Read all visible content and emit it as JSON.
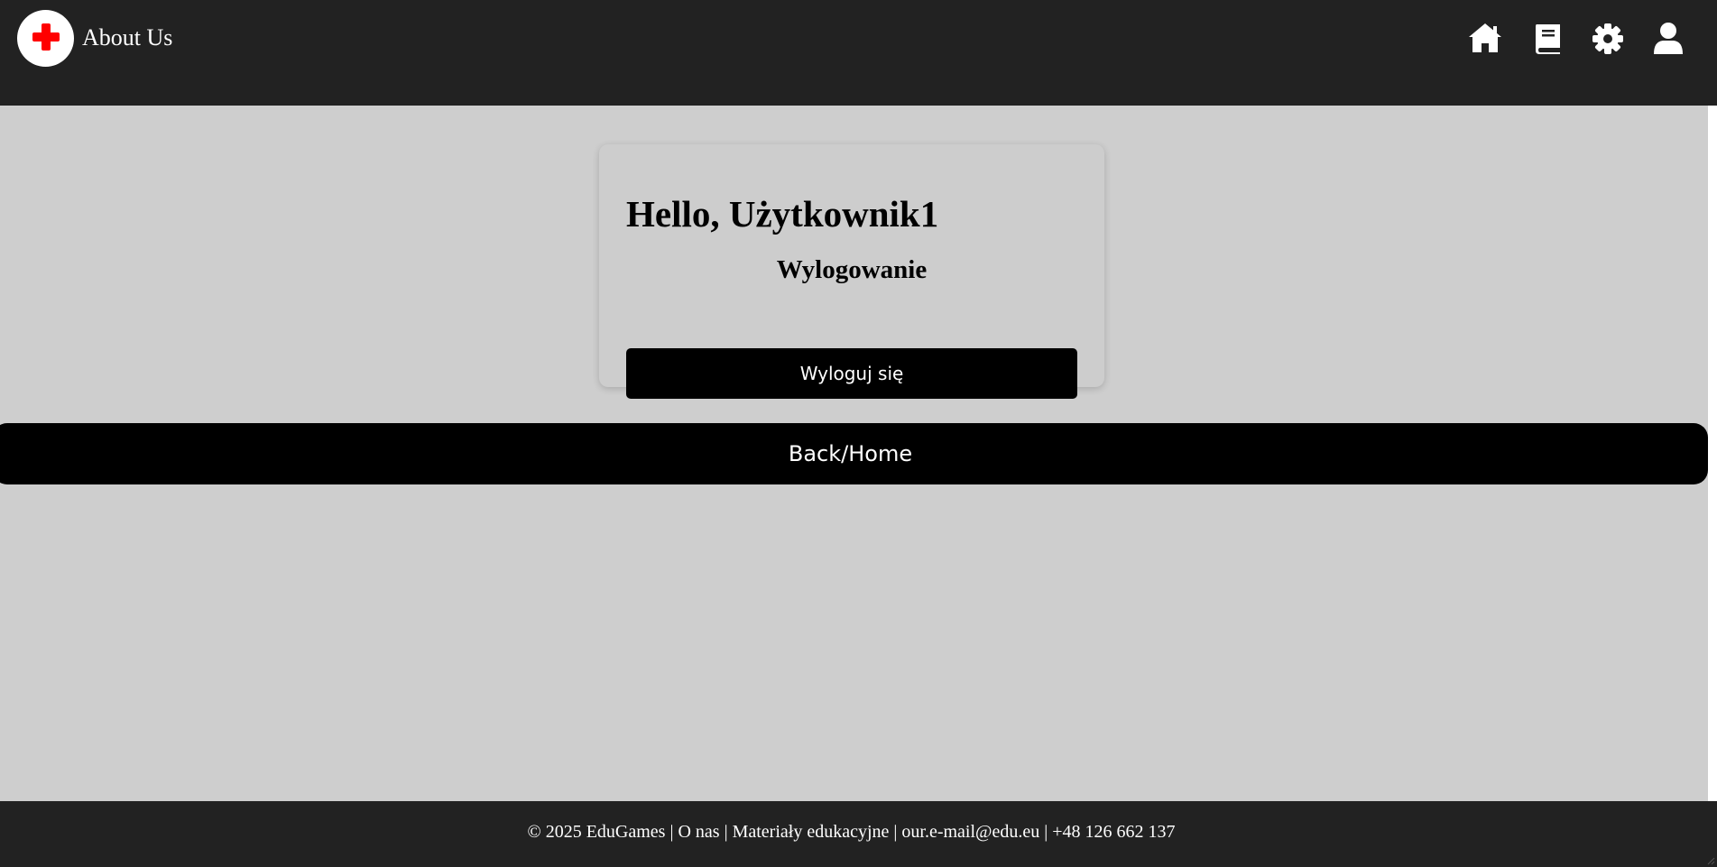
{
  "header": {
    "logo_icon": "red-cross-icon",
    "title": "About Us",
    "nav": [
      {
        "name": "home-icon"
      },
      {
        "name": "book-icon"
      },
      {
        "name": "gear-icon"
      },
      {
        "name": "user-icon"
      }
    ]
  },
  "card": {
    "greeting": "Hello, Użytkownik1",
    "section_title": "Wylogowanie",
    "logout_label": "Wyloguj się"
  },
  "back_button": {
    "label": "Back/Home"
  },
  "footer": {
    "text": "© 2025 EduGames | O nas | Materiały edukacyjne | our.e-mail@edu.eu | +48 126 662 137"
  },
  "colors": {
    "header_bg": "#222222",
    "page_bg": "#cecece",
    "button_bg": "#000000",
    "logo_cross": "#ff0000"
  }
}
